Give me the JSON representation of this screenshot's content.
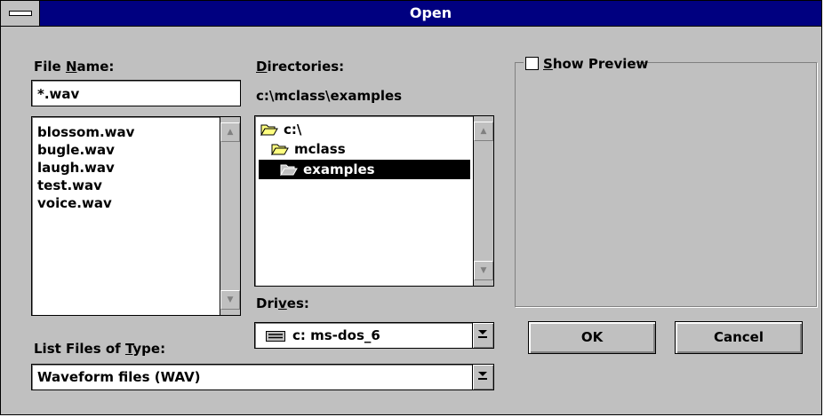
{
  "dialog": {
    "title": "Open"
  },
  "file_name": {
    "label_pre": "File ",
    "label_key": "N",
    "label_post": "ame:",
    "value": "*.wav",
    "files": [
      "blossom.wav",
      "bugle.wav",
      "laugh.wav",
      "test.wav",
      "voice.wav"
    ]
  },
  "directories": {
    "label_key": "D",
    "label_post": "irectories:",
    "current_path": "c:\\mclass\\examples",
    "items": [
      "c:\\",
      "mclass",
      "examples"
    ],
    "selected": "examples"
  },
  "file_type": {
    "label_pre": "List Files of ",
    "label_key": "T",
    "label_post": "ype:",
    "value": "Waveform files (WAV)"
  },
  "drives": {
    "label_pre": "Dri",
    "label_key": "v",
    "label_post": "es:",
    "value": "c: ms-dos_6"
  },
  "preview": {
    "label_key": "S",
    "label_post": "how Preview",
    "checked": false
  },
  "buttons": {
    "ok": "OK",
    "cancel": "Cancel"
  }
}
